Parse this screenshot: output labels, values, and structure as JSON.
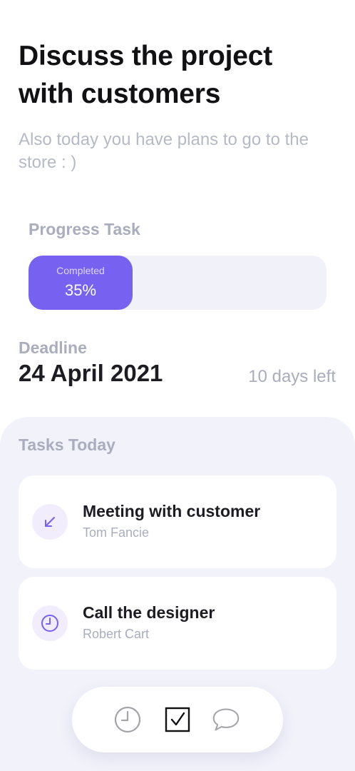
{
  "header": {
    "title": "Discuss the project with customers",
    "subtitle": "Also today you have plans to go to the store : )"
  },
  "progress": {
    "label": "Progress Task",
    "status_label": "Completed",
    "percent_text": "35%",
    "percent": 35
  },
  "deadline": {
    "label": "Deadline",
    "date": "24 April 2021",
    "days_left": "10 days left"
  },
  "tasks": {
    "title": "Tasks Today",
    "items": [
      {
        "name": "Meeting with customer",
        "person": "Tom Fancie",
        "icon": "arrow-down-left-icon"
      },
      {
        "name": "Call the designer",
        "person": "Robert Cart",
        "icon": "clock-icon"
      }
    ]
  },
  "bottom_nav": {
    "items": [
      {
        "icon": "clock-icon"
      },
      {
        "icon": "checkbox-icon",
        "active": true
      },
      {
        "icon": "chat-bubble-icon"
      }
    ]
  },
  "colors": {
    "accent": "#7661f0",
    "muted_text": "#a9adbd",
    "panel_bg": "#f2f2fb"
  }
}
